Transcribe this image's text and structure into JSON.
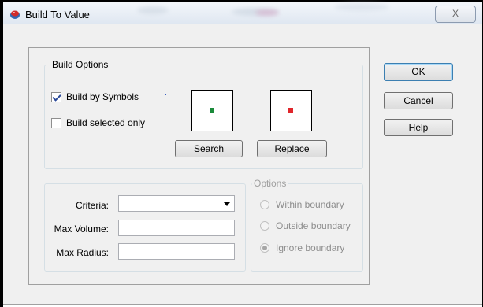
{
  "window": {
    "title": "Build To Value",
    "close_label": "X"
  },
  "build_options": {
    "legend": "Build Options",
    "build_by_symbols": {
      "label": "Build by Symbols",
      "checked": true
    },
    "build_selected_only": {
      "label": "Build selected only",
      "checked": false
    },
    "search_swatch_color": "#1a8a3a",
    "replace_swatch_color": "#e0262b",
    "search_label": "Search",
    "replace_label": "Replace"
  },
  "criteria": {
    "criteria_label": "Criteria:",
    "criteria_value": "",
    "max_volume_label": "Max Volume:",
    "max_volume_value": "",
    "max_radius_label": "Max Radius:",
    "max_radius_value": ""
  },
  "options": {
    "legend": "Options",
    "enabled": false,
    "selected": "Ignore boundary",
    "items": [
      "Within boundary",
      "Outside boundary",
      "Ignore boundary"
    ]
  },
  "buttons": {
    "ok": "OK",
    "cancel": "Cancel",
    "help": "Help"
  }
}
